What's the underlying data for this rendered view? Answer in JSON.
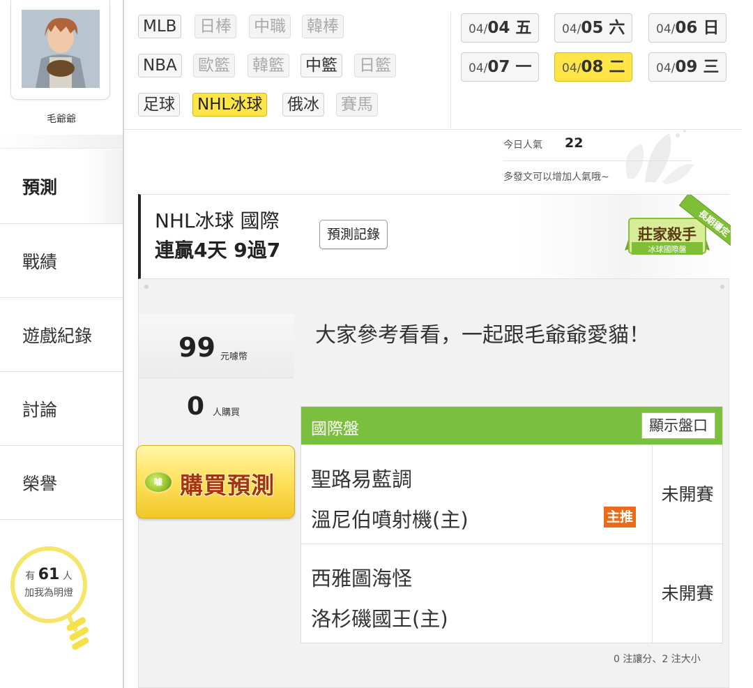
{
  "user": {
    "name": "毛爺爺",
    "avatar_icon": "avatar-photo"
  },
  "sidebar": {
    "items": [
      {
        "label": "預測",
        "active": true
      },
      {
        "label": "戰績",
        "active": false
      },
      {
        "label": "遊戲紀錄",
        "active": false
      },
      {
        "label": "討論",
        "active": false
      },
      {
        "label": "榮譽",
        "active": false
      }
    ],
    "fans": {
      "prefix": "有",
      "count": "61",
      "suffix": "人",
      "caption": "加我為明燈"
    }
  },
  "sports": {
    "row1": [
      "MLB",
      "日棒",
      "中職",
      "韓棒"
    ],
    "row2": [
      "NBA",
      "歐籃",
      "韓籃",
      "中籃",
      "日籃"
    ],
    "row3": [
      "足球",
      "NHL冰球",
      "俄冰",
      "賽馬"
    ]
  },
  "dates": [
    {
      "md": "04/",
      "d": "04 五"
    },
    {
      "md": "04/",
      "d": "05 六"
    },
    {
      "md": "04/",
      "d": "06 日"
    },
    {
      "md": "04/",
      "d": "07 一"
    },
    {
      "md": "04/",
      "d": "08 二"
    },
    {
      "md": "04/",
      "d": "09 三"
    }
  ],
  "popularity": {
    "label": "今日人氣",
    "value": "22",
    "hint": "多發文可以增加人氣哦~"
  },
  "prediction": {
    "title_line1": "NHL冰球 國際",
    "title_line2": "連贏4天 9過7",
    "record_button": "預測記錄",
    "badge_main": "莊家殺手",
    "badge_sub": "冰球國際盤",
    "ribbon": "長期穩定"
  },
  "purchase": {
    "price": "99",
    "price_unit": "元噱幣",
    "buyers": "0",
    "buyers_unit": "人購買",
    "buy_button": "購買預測",
    "coin_label": "噱"
  },
  "message": "大家參考看看，一起跟毛爺爺愛貓！",
  "games_table": {
    "title": "國際盤",
    "show_odds_button": "顯示盤口",
    "games": [
      {
        "away": "聖路易藍調",
        "home": "溫尼伯噴射機(主)",
        "status": "未開賽",
        "recommend": "主推"
      },
      {
        "away": "西雅圖海怪",
        "home": "洛杉磯國王(主)",
        "status": "未開賽",
        "recommend": ""
      }
    ],
    "footer": "0 注讓分、2 注大小"
  },
  "colors": {
    "active_yellow": "#ffe545",
    "table_green": "#7bbf3f",
    "recommend_orange": "#ea6c1a",
    "buy_text": "#a3340e"
  }
}
